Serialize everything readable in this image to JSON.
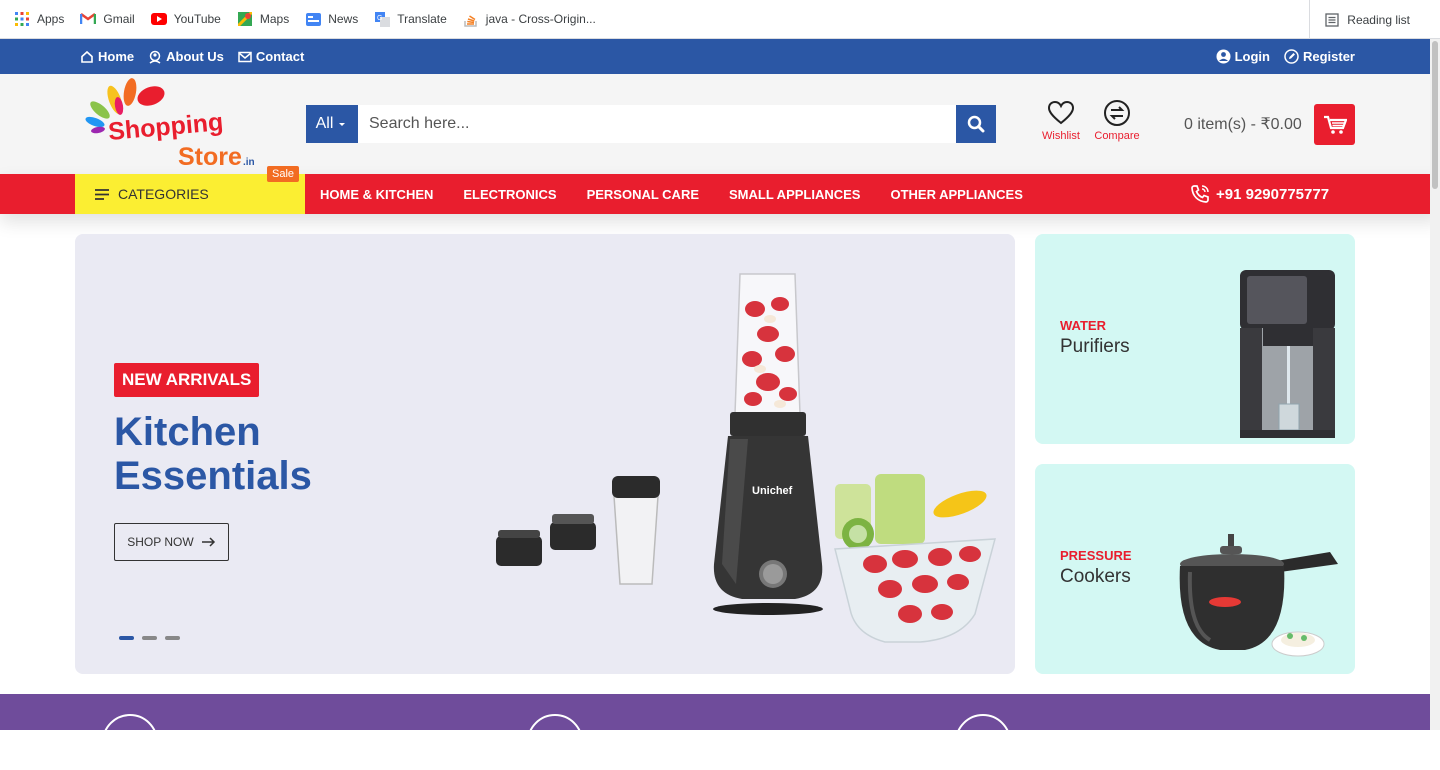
{
  "bookmarks": [
    {
      "label": "Apps",
      "icon": "apps-grid-icon"
    },
    {
      "label": "Gmail",
      "icon": "gmail-icon"
    },
    {
      "label": "YouTube",
      "icon": "youtube-icon"
    },
    {
      "label": "Maps",
      "icon": "maps-icon"
    },
    {
      "label": "News",
      "icon": "news-icon"
    },
    {
      "label": "Translate",
      "icon": "translate-icon"
    },
    {
      "label": "java - Cross-Origin...",
      "icon": "stackoverflow-icon"
    }
  ],
  "reading_list": "Reading list",
  "topbar": {
    "home": "Home",
    "about": "About Us",
    "contact": "Contact",
    "login": "Login",
    "register": "Register"
  },
  "logo": {
    "line1": "Shopping",
    "line2": "Store",
    "suffix": ".in"
  },
  "search": {
    "category": "All",
    "placeholder": "Search here..."
  },
  "header": {
    "wishlist": "Wishlist",
    "compare": "Compare",
    "cart": "0 item(s) - ₹0.00"
  },
  "nav": {
    "categories": "CATEGORIES",
    "sale": "Sale",
    "items": [
      "HOME & KITCHEN",
      "ELECTRONICS",
      "PERSONAL CARE",
      "SMALL APPLIANCES",
      "OTHER APPLIANCES"
    ],
    "phone": "+91 9290775777"
  },
  "hero": {
    "badge": "NEW ARRIVALS",
    "title_line1": "Kitchen",
    "title_line2": "Essentials",
    "button": "SHOP NOW",
    "brand": "Unichef"
  },
  "side_banners": [
    {
      "small": "WATER",
      "big": "Purifiers"
    },
    {
      "small": "PRESSURE",
      "big": "Cookers"
    }
  ],
  "colors": {
    "primary_blue": "#2b57a5",
    "accent_red": "#e91e2e",
    "yellow": "#fbee32",
    "mint": "#d3f8f3",
    "purple": "#6f4c9b"
  }
}
